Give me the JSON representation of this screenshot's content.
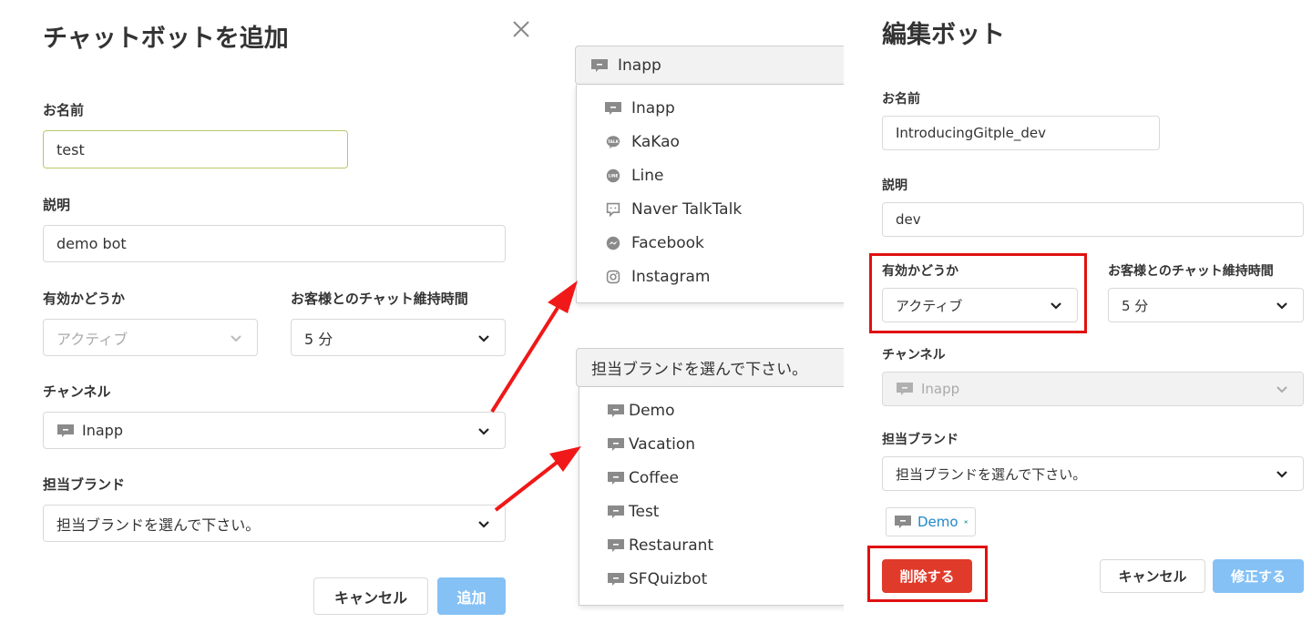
{
  "left": {
    "title": "チャットボットを追加",
    "name_label": "お名前",
    "name_value": "test",
    "desc_label": "説明",
    "desc_value": "demo bot",
    "active_label": "有効かどうか",
    "active_value": "アクティブ",
    "time_label": "お客様とのチャット維持時間",
    "time_value": "5 分",
    "channel_label": "チャンネル",
    "channel_value": "Inapp",
    "brand_label": "担当ブランド",
    "brand_placeholder": "担当ブランドを選んで下さい。",
    "cancel_label": "キャンセル",
    "add_label": "追加"
  },
  "channel_dropdown": {
    "selected": "Inapp",
    "options": [
      {
        "label": "Inapp",
        "icon": "chat-icon"
      },
      {
        "label": "KaKao",
        "icon": "kakao-talk-icon"
      },
      {
        "label": "Line",
        "icon": "line-icon"
      },
      {
        "label": "Naver TalkTalk",
        "icon": "naver-talktalk-icon"
      },
      {
        "label": "Facebook",
        "icon": "messenger-icon"
      },
      {
        "label": "Instagram",
        "icon": "instagram-icon"
      }
    ]
  },
  "brand_dropdown": {
    "placeholder": "担当ブランドを選んで下さい。",
    "options": [
      {
        "label": "Demo",
        "icon": "chat-icon"
      },
      {
        "label": "Vacation",
        "icon": "chat-icon"
      },
      {
        "label": "Coffee",
        "icon": "chat-icon"
      },
      {
        "label": "Test",
        "icon": "chat-icon"
      },
      {
        "label": "Restaurant",
        "icon": "chat-icon"
      },
      {
        "label": "SFQuizbot",
        "icon": "chat-icon"
      }
    ]
  },
  "right": {
    "title": "編集ボット",
    "name_label": "お名前",
    "name_value": "IntroducingGitple_dev",
    "desc_label": "説明",
    "desc_value": "dev",
    "active_label": "有効かどうか",
    "active_value": "アクティブ",
    "time_label": "お客様とのチャット維持時間",
    "time_value": "5 分",
    "channel_label": "チャンネル",
    "channel_value": "Inapp",
    "brand_label": "担当ブランド",
    "brand_placeholder": "担当ブランドを選んで下さい。",
    "brand_tag": "Demo",
    "delete_label": "削除する",
    "cancel_label": "キャンセル",
    "update_label": "修正する"
  },
  "colors": {
    "accent_blue": "#85c1f5",
    "delete_red": "#e03a2a",
    "highlight_red": "#e01010",
    "tag_blue": "#1e88c8",
    "focus_green": "#b5c96a"
  }
}
